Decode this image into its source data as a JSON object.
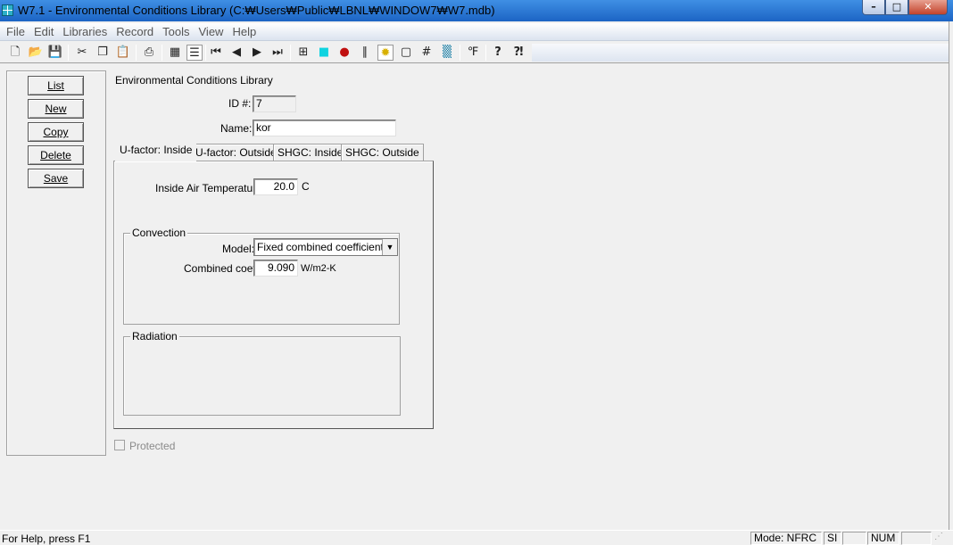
{
  "window": {
    "title": "W7.1 - Environmental Conditions Library (C:₩Users₩Public₩LBNL₩WINDOW7₩W7.mdb)",
    "controls": {
      "minimize": "–",
      "maximize": "□",
      "close": "✕"
    }
  },
  "menu": [
    "File",
    "Edit",
    "Libraries",
    "Record",
    "Tools",
    "View",
    "Help"
  ],
  "toolbar": {
    "icons": [
      {
        "name": "new-file-icon",
        "glyph": "🗋"
      },
      {
        "name": "open-folder-icon",
        "glyph": "📂"
      },
      {
        "name": "save-disk-icon",
        "glyph": "💾"
      },
      {
        "name": "cut-icon",
        "glyph": "✂"
      },
      {
        "name": "copy-icon",
        "glyph": "❐"
      },
      {
        "name": "paste-icon",
        "glyph": "📋"
      },
      {
        "name": "print-icon",
        "glyph": "⎙"
      },
      {
        "name": "grid-view-icon",
        "glyph": "▦"
      },
      {
        "name": "list-view-icon",
        "glyph": "☰"
      },
      {
        "name": "first-record-icon",
        "glyph": "⏮"
      },
      {
        "name": "previous-record-icon",
        "glyph": "◀"
      },
      {
        "name": "next-record-icon",
        "glyph": "▶"
      },
      {
        "name": "last-record-icon",
        "glyph": "⏭"
      },
      {
        "name": "window-grid-icon",
        "glyph": "⊞"
      },
      {
        "name": "glazing-icon",
        "glyph": "■"
      },
      {
        "name": "thermal-icon",
        "glyph": "●"
      },
      {
        "name": "frame-icon",
        "glyph": "∥"
      },
      {
        "name": "temperature-icon",
        "glyph": "✹"
      },
      {
        "name": "square-frame-icon",
        "glyph": "▢"
      },
      {
        "name": "hash-icon",
        "glyph": "#"
      },
      {
        "name": "hatch-icon",
        "glyph": "▒"
      },
      {
        "name": "units-fc-icon",
        "glyph": "℉"
      },
      {
        "name": "help-icon",
        "glyph": "?"
      },
      {
        "name": "context-help-icon",
        "glyph": "⁈"
      }
    ]
  },
  "commands": [
    "List",
    "New",
    "Copy",
    "Delete",
    "Save"
  ],
  "form": {
    "heading": "Environmental Conditions Library",
    "id_label": "ID #:",
    "id_value": "7",
    "name_label": "Name:",
    "name_value": "kor"
  },
  "tabs": [
    "U-factor: Inside",
    "U-factor: Outside",
    "SHGC: Inside",
    "SHGC: Outside"
  ],
  "active_tab": "U-factor: Inside",
  "inside_air": {
    "label": "Inside Air Temperature",
    "value": "20.0",
    "unit": "C"
  },
  "convection": {
    "legend": "Convection",
    "model_label": "Model:",
    "model_value": "Fixed combined coefficient",
    "coef_label": "Combined coef.",
    "coef_value": "9.090",
    "coef_unit": "W/m2-K"
  },
  "radiation": {
    "legend": "Radiation"
  },
  "protected": {
    "label": "Protected",
    "checked": false
  },
  "status": {
    "help": "For Help, press F1",
    "mode": "Mode: NFRC",
    "units": "SI",
    "num": "NUM"
  }
}
